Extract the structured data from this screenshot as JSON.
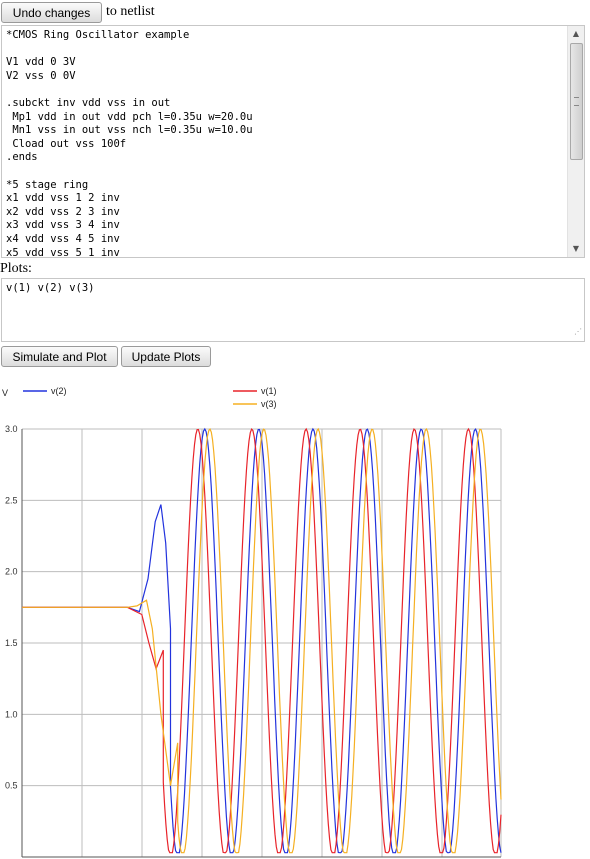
{
  "toolbar": {
    "undo_label": "Undo changes",
    "undo_suffix": "to netlist"
  },
  "netlist": {
    "text": "*CMOS Ring Oscillator example\n\nV1 vdd 0 3V\nV2 vss 0 0V\n\n.subckt inv vdd vss in out\n Mp1 vdd in out vdd pch l=0.35u w=20.0u\n Mn1 vss in out vss nch l=0.35u w=10.0u\n Cload out vss 100f\n.ends\n\n*5 stage ring\nx1 vdd vss 1 2 inv\nx2 vdd vss 2 3 inv\nx3 vdd vss 3 4 inv\nx4 vdd vss 4 5 inv\nx5 vdd vss 5 1 inv"
  },
  "plots": {
    "label": "Plots:",
    "value": "v(1) v(2) v(3)"
  },
  "actions": {
    "simulate_label": "Simulate and Plot",
    "update_label": "Update Plots"
  },
  "icons": {
    "scroll_up": "scroll-up-arrow-icon",
    "scroll_down": "scroll-down-arrow-icon",
    "resize": "resize-grip-icon"
  },
  "chart_data": {
    "type": "line",
    "ylabel": "V",
    "ylim": [
      0,
      3.0
    ],
    "y_ticks": [
      "3.0",
      "2.5",
      "2.0",
      "1.5",
      "1.0",
      "0.5"
    ],
    "grid": true,
    "legend": "top",
    "series": [
      {
        "name": "v(2)",
        "color": "#2233dd"
      },
      {
        "name": "v(1)",
        "color": "#e8232a"
      },
      {
        "name": "v(3)",
        "color": "#f5b022"
      }
    ],
    "x_positions": "unlabeled",
    "initial_level": 1.75,
    "period_fraction": 0.113,
    "v2_transient_peak": 2.47,
    "v3_transient_min": 0.5
  }
}
